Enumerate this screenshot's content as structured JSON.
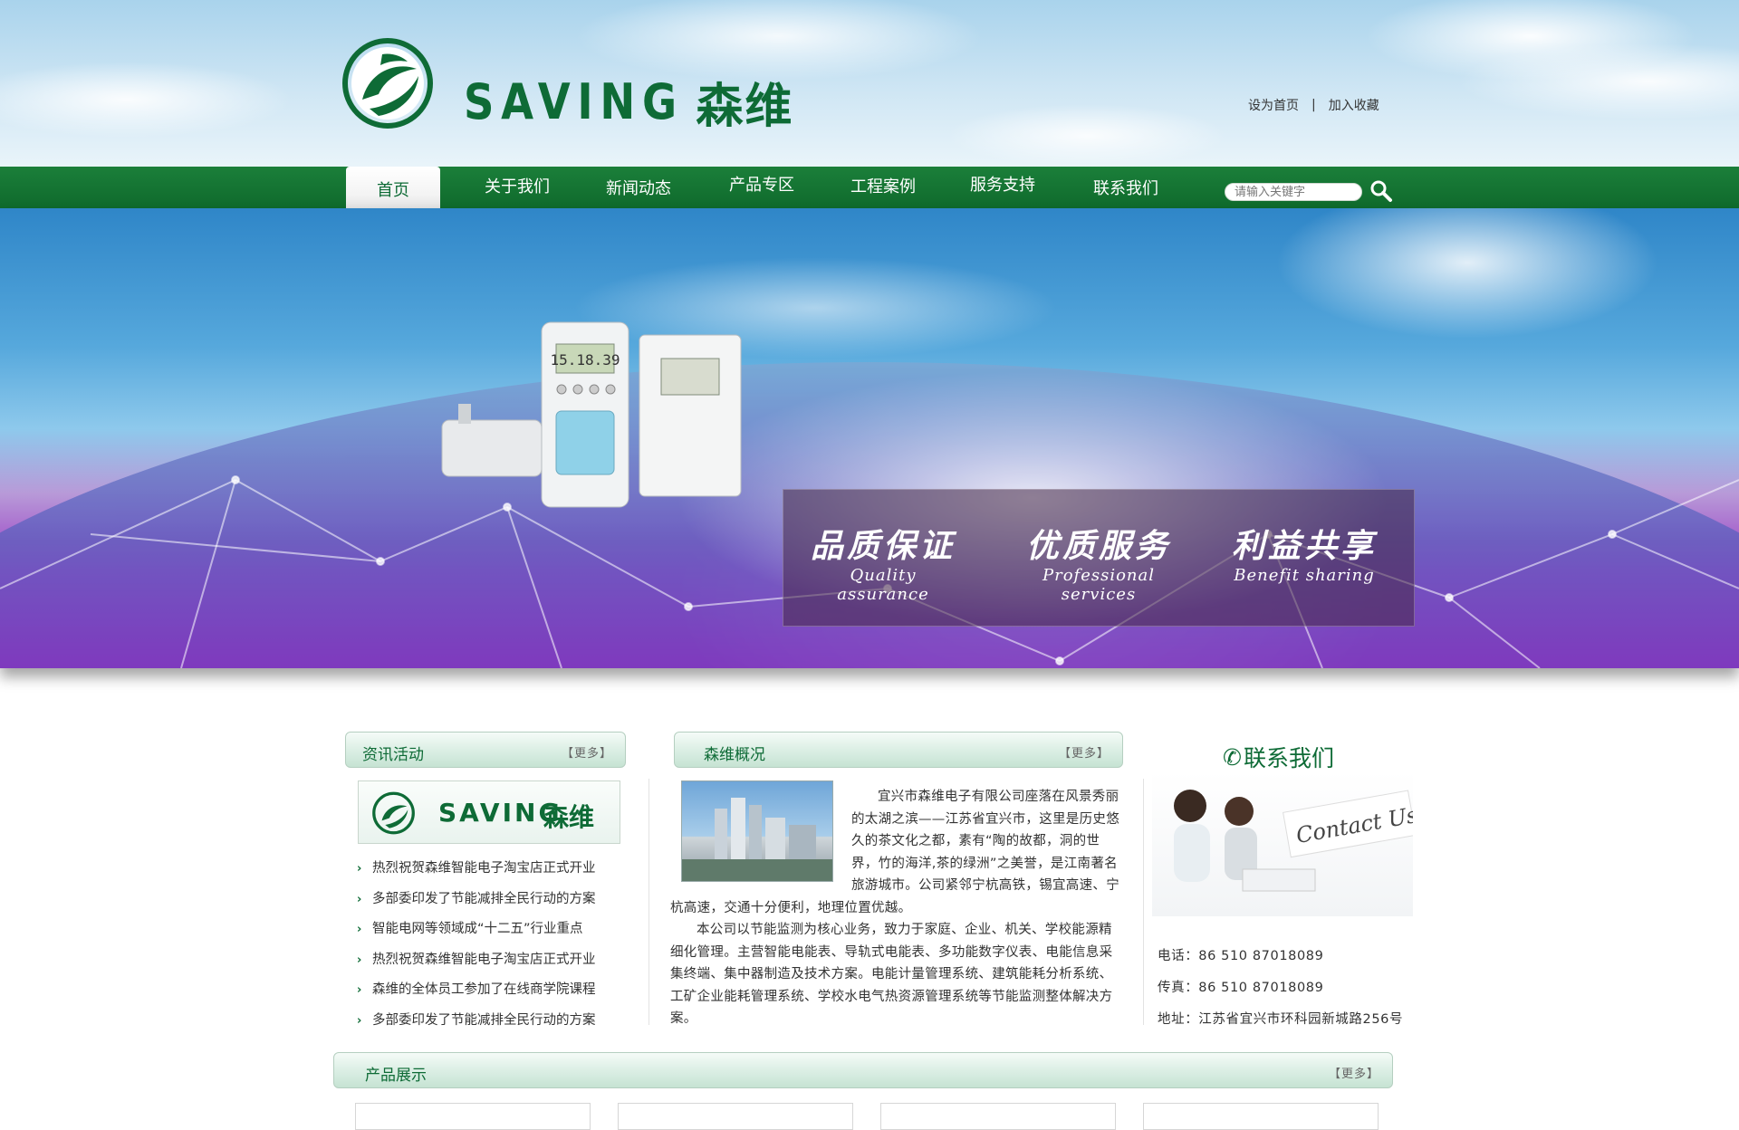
{
  "brand": {
    "en": "SAVING",
    "cn": "森维"
  },
  "toplinks": {
    "home": "设为首页",
    "sep": "|",
    "favorite": "加入收藏"
  },
  "nav": {
    "items": [
      "首页",
      "关于我们",
      "新闻动态",
      "产品专区",
      "工程案例",
      "服务支持",
      "联系我们"
    ],
    "active": 0
  },
  "search": {
    "placeholder": "请输入关键字"
  },
  "banner": {
    "slogans": [
      {
        "cn": "品质保证",
        "en": "Quality assurance"
      },
      {
        "cn": "优质服务",
        "en": "Professional services"
      },
      {
        "cn": "利益共享",
        "en": "Benefit sharing"
      }
    ]
  },
  "news": {
    "title": "资讯活动",
    "more": "【更多】",
    "logo_en": "SAVING",
    "logo_cn": "森维",
    "items": [
      "热烈祝贺森维智能电子淘宝店正式开业",
      "多部委印发了节能减排全民行动的方案",
      "智能电网等领域成“十二五”行业重点",
      "热烈祝贺森维智能电子淘宝店正式开业",
      "森维的全体员工参加了在线商学院课程",
      "多部委印发了节能减排全民行动的方案"
    ]
  },
  "about": {
    "title": "森维概况",
    "more": "【更多】",
    "para1": "宜兴市森维电子有限公司座落在风景秀丽的太湖之滨——江苏省宜兴市，这里是历史悠久的茶文化之都，素有“陶的故都，洞的世界，竹的海洋,茶的绿洲”之美誉，是江南著名旅游城市。公司紧邻宁杭高铁，锡宜高速、宁杭高速，交通十分便利，地理位置优越。",
    "para2": "本公司以节能监测为核心业务，致力于家庭、企业、机关、学校能源精细化管理。主营智能电能表、导轨式电能表、多功能数字仪表、电能信息采集终端、集中器制造及技术方案。电能计量管理系统、建筑能耗分析系统、工矿企业能耗管理系统、学校水电气热资源管理系统等节能监测整体解决方案。"
  },
  "contact": {
    "title": "联系我们",
    "image_text": "Contact Us!",
    "phone": "电话：86 510 87018089",
    "fax": "传真：86 510 87018089",
    "address": "地址：江苏省宜兴市环科园新城路256号"
  },
  "products": {
    "title": "产品展示",
    "more": "【更多】"
  },
  "colors": {
    "brand_green": "#0e6b36",
    "nav_green": "#157532"
  },
  "icons": [
    "logo-mark-icon",
    "search-icon",
    "arrow-right-icon",
    "phone-icon"
  ]
}
